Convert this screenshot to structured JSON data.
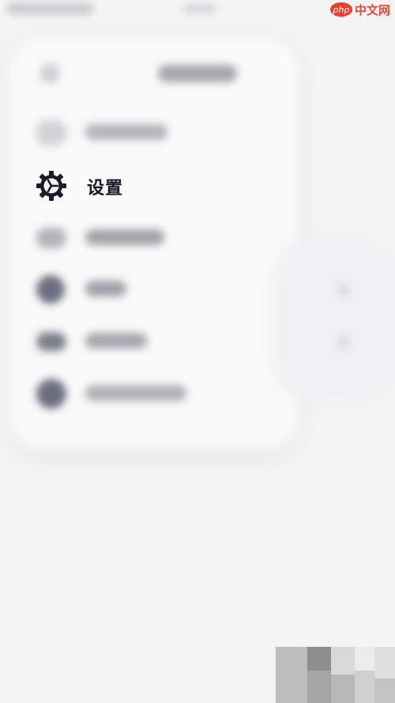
{
  "watermark": {
    "logo_text": "php",
    "site_text": "中文网"
  },
  "settings_item": {
    "label": "设置",
    "icon": "gear-icon"
  },
  "menu": [
    {
      "name": "blurred-item-1",
      "icon": "phone-icon"
    },
    {
      "name": "settings",
      "icon": "gear-icon",
      "label": "设置"
    },
    {
      "name": "blurred-item-3",
      "icon": "card-icon"
    },
    {
      "name": "blurred-item-4",
      "icon": "circle-icon"
    },
    {
      "name": "blurred-item-5",
      "icon": "folder-icon"
    },
    {
      "name": "blurred-item-6",
      "icon": "circle-icon"
    }
  ]
}
